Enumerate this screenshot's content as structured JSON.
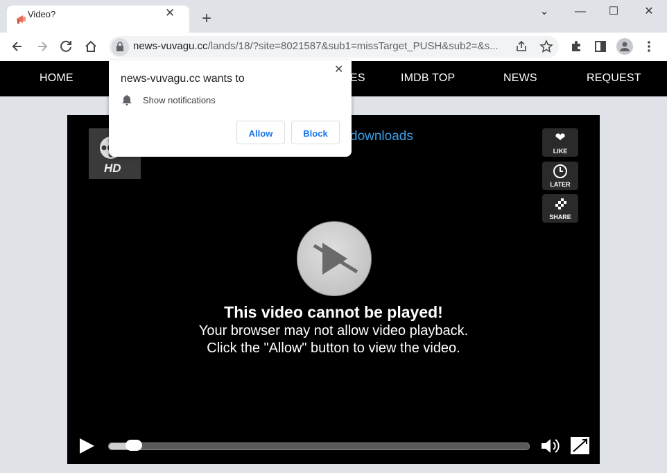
{
  "browser": {
    "tab_title": "Video?",
    "tab_close": "✕",
    "new_tab": "+",
    "window_controls": {
      "dropdown": "⌄",
      "minimize": "—",
      "maximize": "☐",
      "close": "✕"
    },
    "url_host": "news-vuvagu.cc",
    "url_rest": "/lands/18/?site=8021587&sub1=missTarget_PUSH&sub2=&s..."
  },
  "nav": {
    "items": [
      "HOME",
      "ES",
      "IMDB TOP",
      "NEWS",
      "REQUEST"
    ]
  },
  "player": {
    "hd_label": "HD",
    "downloads_link": "downloads",
    "side_buttons": {
      "like": "LIKE",
      "later": "LATER",
      "share": "SHARE"
    },
    "message_title": "This video cannot be played!",
    "message_line1": "Your browser may not allow video playback.",
    "message_line2": "Click the \"Allow\" button to view the video.",
    "progress_fraction": 0.04
  },
  "popup": {
    "title": "news-vuvagu.cc wants to",
    "permission": "Show notifications",
    "close": "✕",
    "allow_label": "Allow",
    "block_label": "Block"
  },
  "colors": {
    "link": "#3aa0e8",
    "button_text": "#1a73e8"
  }
}
